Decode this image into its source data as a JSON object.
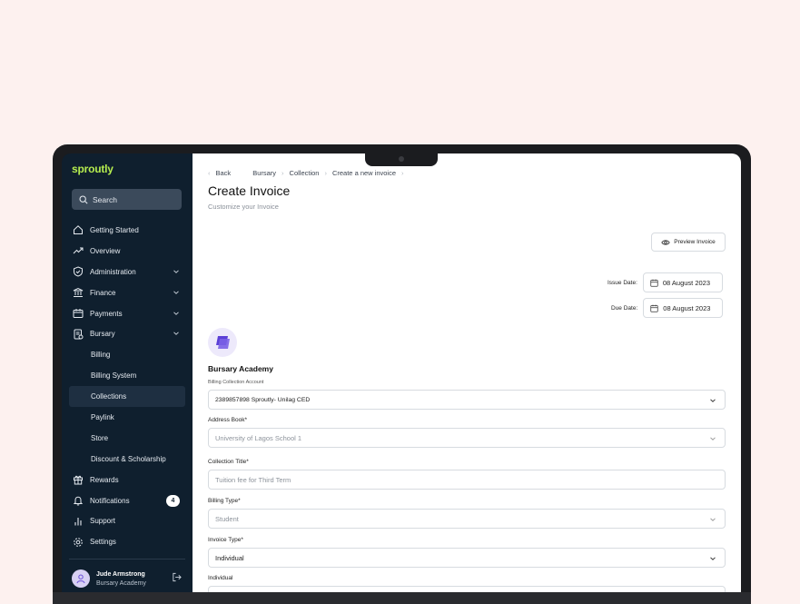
{
  "app": {
    "logo": "sproutly"
  },
  "search": {
    "label": "Search"
  },
  "nav": [
    {
      "label": "Getting Started",
      "icon": "home-icon"
    },
    {
      "label": "Overview",
      "icon": "trend-icon"
    },
    {
      "label": "Administration",
      "icon": "shield-icon",
      "expandable": true
    },
    {
      "label": "Finance",
      "icon": "bank-icon",
      "expandable": true
    },
    {
      "label": "Payments",
      "icon": "wallet-icon",
      "expandable": true
    },
    {
      "label": "Bursary",
      "icon": "receipt-icon",
      "expandable": true
    },
    {
      "label": "Billing",
      "sub": true
    },
    {
      "label": "Billing System",
      "sub": true
    },
    {
      "label": "Collections",
      "sub": true,
      "active": true
    },
    {
      "label": "Paylink",
      "sub": true
    },
    {
      "label": "Store",
      "sub": true
    },
    {
      "label": "Discount & Scholarship",
      "sub": true
    },
    {
      "label": "Rewards",
      "icon": "gift-icon"
    },
    {
      "label": "Notifications",
      "icon": "bell-icon",
      "badge": "4"
    },
    {
      "label": "Support",
      "icon": "chart-icon"
    },
    {
      "label": "Settings",
      "icon": "gear-icon"
    }
  ],
  "user": {
    "name": "Jude Armstrong",
    "org": "Bursary Academy"
  },
  "breadcrumb": {
    "back": "Back",
    "items": [
      "Bursary",
      "Collection",
      "Create a new invoice"
    ]
  },
  "page": {
    "title": "Create Invoice",
    "subtitle": "Customize your Invoice"
  },
  "preview_button": "Preview Invoice",
  "dates": {
    "issue_label": "Issue Date:",
    "issue_value": "08 August 2023",
    "due_label": "Due Date:",
    "due_value": "08 August 2023"
  },
  "org": {
    "name": "Bursary Academy"
  },
  "form": {
    "billing_account_label": "Billing Collection Account",
    "billing_account_value": "2389857898 Sproutly- Unilag CED",
    "address_label": "Address Book*",
    "address_value": "University of Lagos School 1",
    "collection_title_label": "Collection Title*",
    "collection_title_placeholder": "Tuition fee for Third Term",
    "billing_type_label": "Billing Type*",
    "billing_type_value": "Student",
    "invoice_type_label": "Invoice Type*",
    "invoice_type_value": "Individual",
    "individual_label": "Individual"
  }
}
